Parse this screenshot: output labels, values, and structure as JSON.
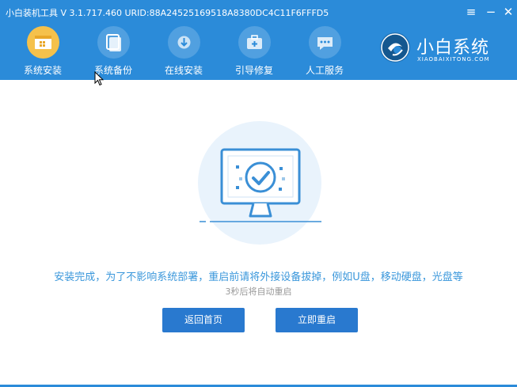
{
  "window": {
    "title": "小白装机工具 V 3.1.717.460 URID:88A24525169518A8380DC4C11F6FFFD5"
  },
  "controls": {
    "menu_icon": "menu-icon",
    "minimize_icon": "minimize-icon",
    "close_icon": "close-icon"
  },
  "nav": {
    "items": [
      {
        "label": "系统安装",
        "icon": "install-icon",
        "active": true
      },
      {
        "label": "系统备份",
        "icon": "backup-icon",
        "active": false
      },
      {
        "label": "在线安装",
        "icon": "download-icon",
        "active": false
      },
      {
        "label": "引导修复",
        "icon": "repair-kit-icon",
        "active": false
      },
      {
        "label": "人工服务",
        "icon": "chat-icon",
        "active": false
      }
    ]
  },
  "logo": {
    "name": "小白系统",
    "sub": "XIAOBAIXITONG.COM"
  },
  "main": {
    "message": "安装完成，为了不影响系统部署，重启前请将外接设备拔掉，例如U盘，移动硬盘，光盘等",
    "countdown": "3秒后将自动重启",
    "back_label": "返回首页",
    "restart_label": "立即重启"
  },
  "colors": {
    "header": "#2b8bd9",
    "active_icon": "#f5c14b",
    "message_text": "#3a97db",
    "button": "#2979cf"
  }
}
